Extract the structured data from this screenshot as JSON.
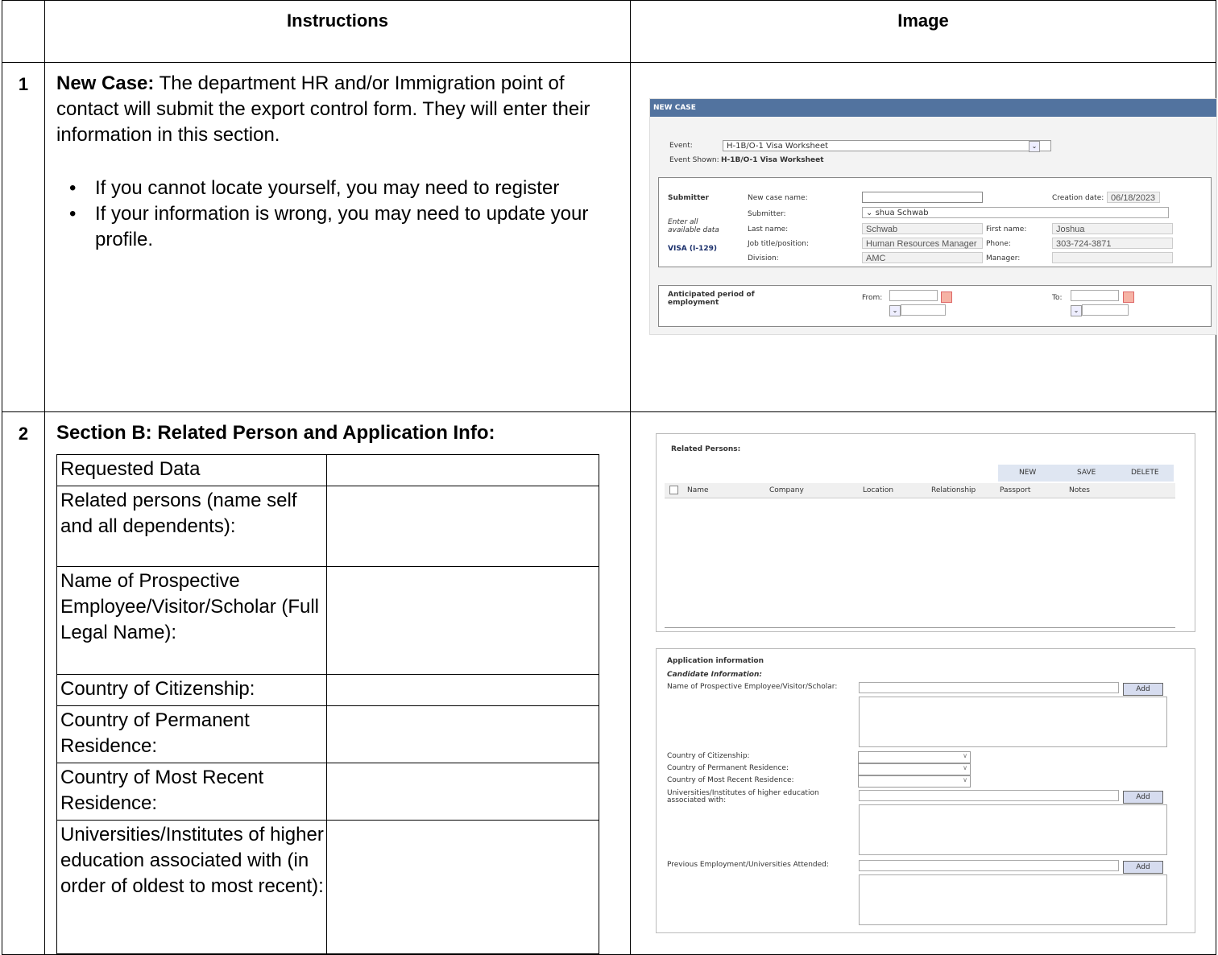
{
  "headers": {
    "instructions": "Instructions",
    "image": "Image"
  },
  "rows": [
    {
      "num": "1",
      "title": "New Case:",
      "text": " The department HR and/or Immigration point of contact will submit the export control form. They will enter their information in this section.",
      "bullets": [
        "If you cannot locate yourself, you may need to register",
        "If your information is wrong, you may need to update your profile."
      ]
    },
    {
      "num": "2",
      "title": "Section B: Related Person and Application Info:"
    }
  ],
  "requested_table": {
    "rows": [
      "Requested Data",
      "Related persons (name self and all dependents):",
      "Name of Prospective Employee/Visitor/Scholar (Full Legal Name):",
      "Country of Citizenship:",
      "Country of Permanent Residence:",
      "Country of Most Recent Residence:",
      "Universities/Institutes of higher education associated with (in order of oldest to most recent):"
    ]
  },
  "new_case": {
    "bar": "NEW CASE",
    "event_label": "Event:",
    "event_value": "H-1B/O-1 Visa Worksheet",
    "event_shown_label": "Event Shown:",
    "event_shown_value": "H-1B/O-1 Visa Worksheet",
    "submitter_heading": "Submitter",
    "enter_all": "Enter all",
    "available_data": "available data",
    "visa": "VISA (I-129)",
    "new_case_name_label": "New case name:",
    "submitter_label": "Submitter:",
    "submitter_value": "shua Schwab",
    "last_name_label": "Last name:",
    "last_name_value": "Schwab",
    "job_title_label": "Job title/position:",
    "job_title_value": "Human Resources Manager",
    "division_label": "Division:",
    "division_value": "AMC",
    "creation_date_label": "Creation date:",
    "creation_date_value": "06/18/2023",
    "first_name_label": "First name:",
    "first_name_value": "Joshua",
    "phone_label": "Phone:",
    "phone_value": "303-724-3871",
    "manager_label": "Manager:",
    "anticipated": "Anticipated period of",
    "employment": "employment",
    "from_label": "From:",
    "to_label": "To:"
  },
  "related": {
    "title": "Related Persons:",
    "buttons": [
      "NEW",
      "SAVE",
      "DELETE"
    ],
    "columns": [
      "Name",
      "Company",
      "Location",
      "Relationship",
      "Passport",
      "Notes"
    ]
  },
  "application": {
    "title": "Application information",
    "subtitle": "Candidate Information:",
    "prospective_label": "Name of Prospective Employee/Visitor/Scholar:",
    "citizenship_label": "Country of Citizenship:",
    "permanent_label": "Country of Permanent Residence:",
    "recent_label": "Country of Most Recent Residence:",
    "universities_label_1": "Universities/Institutes of higher education",
    "universities_label_2": "associated with:",
    "previous_label": "Previous Employment/Universities Attended:",
    "add_label": "Add"
  }
}
